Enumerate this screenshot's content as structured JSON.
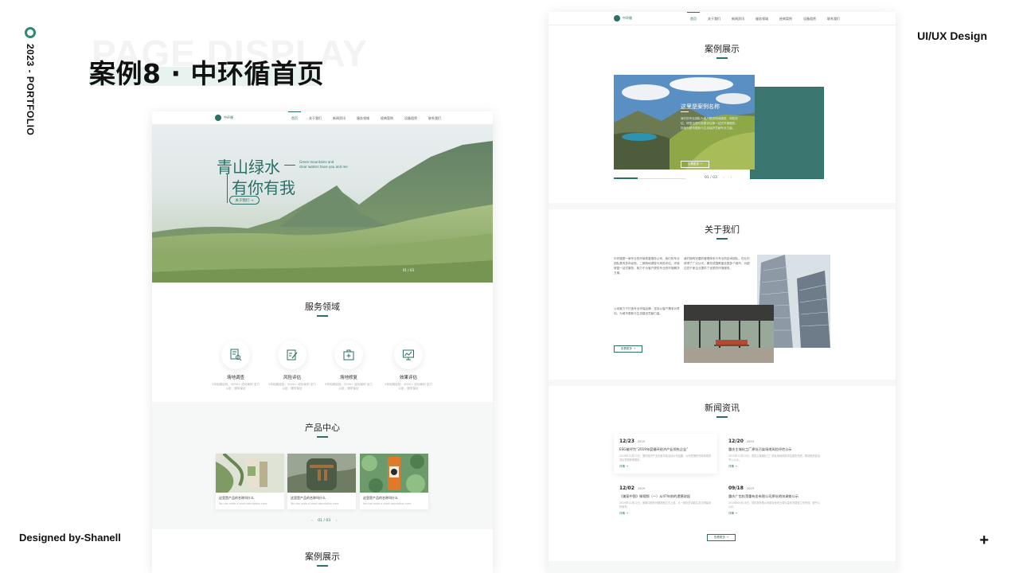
{
  "portfolio": {
    "year_label": "2023 - PORTFOLIO",
    "bg_word": "PAGE DISPLAY",
    "title": "案例8 · 中环循首页",
    "tag": "UI/UX Design",
    "designer": "Designed by-Shanell",
    "plus": "+"
  },
  "nav": {
    "logo_name": "中环循",
    "items": [
      "首页",
      "关于我们",
      "新闻资讯",
      "服务领域",
      "经典案例",
      "设备租赁",
      "联系我们"
    ]
  },
  "hero": {
    "title_line1": "青山绿水",
    "title_line2": "有你有我",
    "en_line1": "Green mountains and",
    "en_line2": "clear waters have you and me",
    "button": "关于我们 →",
    "page_indicator": "01 / 03"
  },
  "services": {
    "title": "服务领域",
    "items": [
      {
        "name": "场地调查",
        "desc": "5年权威经验，3000+ 成功案例 全力以赴，服务保证"
      },
      {
        "name": "风险评估",
        "desc": "5年权威经验，3000+ 成功案例 全力以赴，服务保证"
      },
      {
        "name": "场地修复",
        "desc": "5年权威经验，3000+ 成功案例 全力以赴，服务保证"
      },
      {
        "name": "效果评估",
        "desc": "5年权威经验，3000+ 成功案例 全力以赴，服务保证"
      }
    ]
  },
  "products": {
    "title": "产品中心",
    "items": [
      {
        "name": "这里是产品的名称叫什么",
        "desc": "You can write a short description here"
      },
      {
        "name": "这里是产品的名称叫什么",
        "desc": "You can write a short description here"
      },
      {
        "name": "这里是产品的名称叫什么",
        "desc": "You can write a short description here"
      }
    ],
    "pager": "01 / 03"
  },
  "cases": {
    "title": "案例展示",
    "card_title": "这里是案例名称",
    "card_text": "我们的专业团队为客户提供场地调查、风险评估、修复治理与效果评估等一站式环境服务，持续为城市更新与生态保护贡献专业力量。",
    "card_button": "查看更多 →",
    "pager": "01 / 03"
  },
  "about": {
    "title": "关于我们",
    "para1": "中环循是一家专业的环境修复服务公司，我们的专业团队具有多年经验，二期场地调查与风险评估、环境修复一站式服务，致力于为客户提供专业的环境解决方案。",
    "para2": "公司致力于打造专业环保品牌，坚持以客户需求为导向，为城市更新与生态建设贡献力量。",
    "para3": "我们拥有完善的管理体系与专业的技术团队，在业内获得了广泛认可，服务范围覆盖全国多个城市，为超过四千家企业提供了优质的环境服务。",
    "button": "查看更多 →"
  },
  "news": {
    "title": "新闻资讯",
    "items": [
      {
        "date": "12/23",
        "year": "2019",
        "title": "ESG被评为“2019年度循环经济产业领先企业”",
        "desc": "2019年12月23日，循环经济产业年度评选活动公布结果，公司凭借在环保领域的突出表现获得表彰。",
        "more": "详情 →"
      },
      {
        "date": "12/20",
        "year": "2019",
        "title": "重庆主城化工厂原址污染场地风险评估公示",
        "desc": "2019年12月20日，重庆主城某化工厂原址场地风险评估报告完成，现将相关信息予以公示。",
        "more": "详情 →"
      },
      {
        "date": "12/02",
        "year": "2019",
        "title": "《美丽中国》微视频（一）从47年前的遗憾说起",
        "desc": "2019年12月02日，美丽中国系列微视频正式上线，从一段历史讲起生态文明建设的故事。",
        "more": "详情 →"
      },
      {
        "date": "09/18",
        "year": "2019",
        "title": "重庆广信松藻重有金有限公司原址地块调查公示",
        "desc": "2019年09月18日，重庆某有限公司原址地块土壤污染状况调查工作完成，现予以公示。",
        "more": "详情 →"
      }
    ],
    "button": "查看更多 →"
  }
}
